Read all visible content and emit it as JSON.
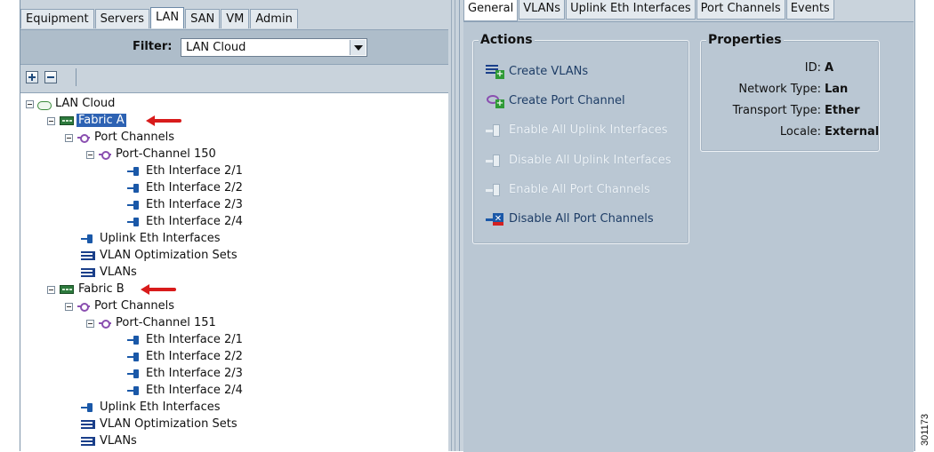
{
  "nav_tabs": [
    "Equipment",
    "Servers",
    "LAN",
    "SAN",
    "VM",
    "Admin"
  ],
  "nav_active_tab": "LAN",
  "filter": {
    "label": "Filter:",
    "value": "LAN Cloud"
  },
  "tree": {
    "root": "LAN Cloud",
    "fabric_a": "Fabric A",
    "fabric_b": "Fabric B",
    "port_channels": "Port Channels",
    "port_channel_150": "Port-Channel 150",
    "port_channel_151": "Port-Channel 151",
    "eth_2_1": "Eth Interface 2/1",
    "eth_2_2": "Eth Interface 2/2",
    "eth_2_3": "Eth Interface 2/3",
    "eth_2_4": "Eth Interface 2/4",
    "uplink": "Uplink Eth Interfaces",
    "vlan_opt": "VLAN Optimization Sets",
    "vlans": "VLANs"
  },
  "content_tabs": [
    "General",
    "VLANs",
    "Uplink Eth Interfaces",
    "Port Channels",
    "Events"
  ],
  "content_active_tab": "General",
  "actions": {
    "title": "Actions",
    "items": [
      {
        "label": "Create VLANs",
        "icon": "create-vlans-icon",
        "enabled": true
      },
      {
        "label": "Create Port Channel",
        "icon": "create-port-channel-icon",
        "enabled": true
      },
      {
        "label": "Enable All Uplink Interfaces",
        "icon": "uplink-interface-icon",
        "enabled": false
      },
      {
        "label": "Disable All Uplink Interfaces",
        "icon": "uplink-interface-icon",
        "enabled": false
      },
      {
        "label": "Enable All Port Channels",
        "icon": "port-channel-icon",
        "enabled": false
      },
      {
        "label": "Disable All Port Channels",
        "icon": "disable-port-channels-icon",
        "enabled": true
      }
    ]
  },
  "properties": {
    "title": "Properties",
    "id_label": "ID:",
    "id_value": "A",
    "network_type_label": "Network Type:",
    "network_type_value": "Lan",
    "transport_type_label": "Transport Type:",
    "transport_type_value": "Ether",
    "locale_label": "Locale:",
    "locale_value": "External"
  },
  "figure_id": "301173",
  "colors": {
    "selection": "#2d62b3",
    "annotation_arrow": "#d81b1b",
    "panel_bg": "#c9d3dc"
  }
}
